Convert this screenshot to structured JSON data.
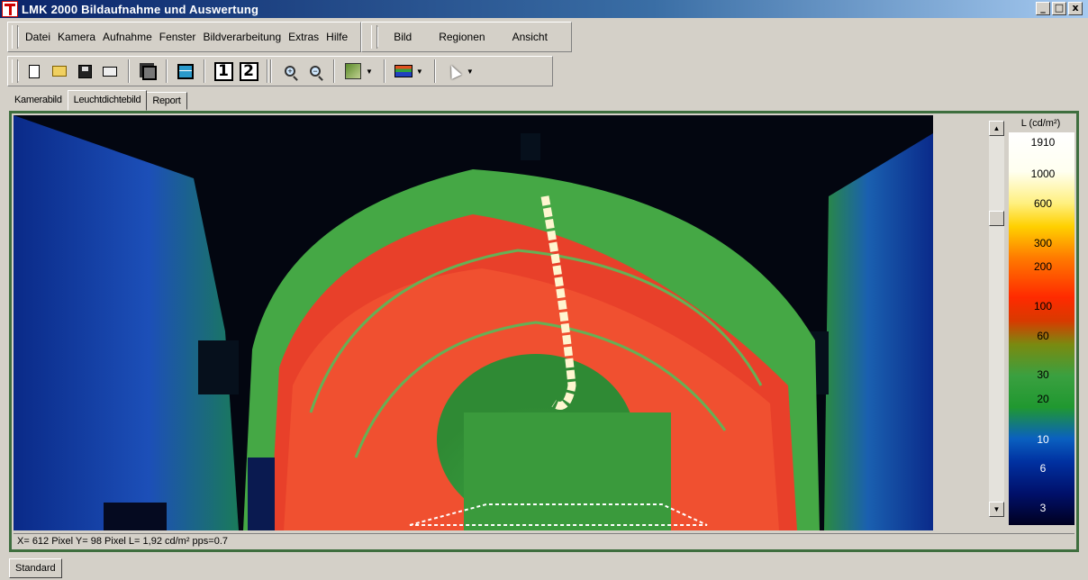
{
  "window": {
    "title": "LMK 2000 Bildaufnahme und Auswertung",
    "buttons": [
      "_",
      "□",
      "x"
    ]
  },
  "menu": {
    "main": [
      "Datei",
      "Kamera",
      "Aufnahme",
      "Fenster",
      "Bildverarbeitung",
      "Extras",
      "Hilfe"
    ],
    "secondary": [
      "Bild",
      "Regionen",
      "Ansicht"
    ]
  },
  "toolbar": {
    "icons": [
      "new-file-icon",
      "open-folder-icon",
      "save-disk-icon",
      "print-icon",
      "windows-icon",
      "tile-icon",
      "view-1-icon",
      "view-2-icon",
      "zoom-in-icon",
      "zoom-out-icon",
      "chart-icon",
      "palette-icon",
      "cursor-icon"
    ],
    "view1_label": "1",
    "view2_label": "2",
    "zoom_in_symbol": "+",
    "zoom_out_symbol": "−"
  },
  "tabs": [
    {
      "label": "Kamerabild",
      "active": false
    },
    {
      "label": "Leuchtdichtebild",
      "active": true
    },
    {
      "label": "Report",
      "active": false
    }
  ],
  "legend": {
    "unit": "L (cd/m²)",
    "labels": [
      "1910",
      "1000",
      "600",
      "300",
      "200",
      "100",
      "60",
      "30",
      "20",
      "10",
      "6",
      "3"
    ],
    "colors": [
      "#ffffff",
      "#fffff0",
      "#fff080",
      "#ffd000",
      "#ff7a00",
      "#ff2a00",
      "#d83a00",
      "#7a8a10",
      "#3aa040",
      "#209830",
      "#0a60c0",
      "#0030a0",
      "#00106a",
      "#000020"
    ]
  },
  "status": {
    "coords": "X= 612 Pixel  Y= 98 Pixel  L= 1,92 cd/m²  pps=0.7"
  },
  "bottom": {
    "profile": "Standard"
  },
  "image": {
    "description_icons": "luminance-false-color-image"
  }
}
